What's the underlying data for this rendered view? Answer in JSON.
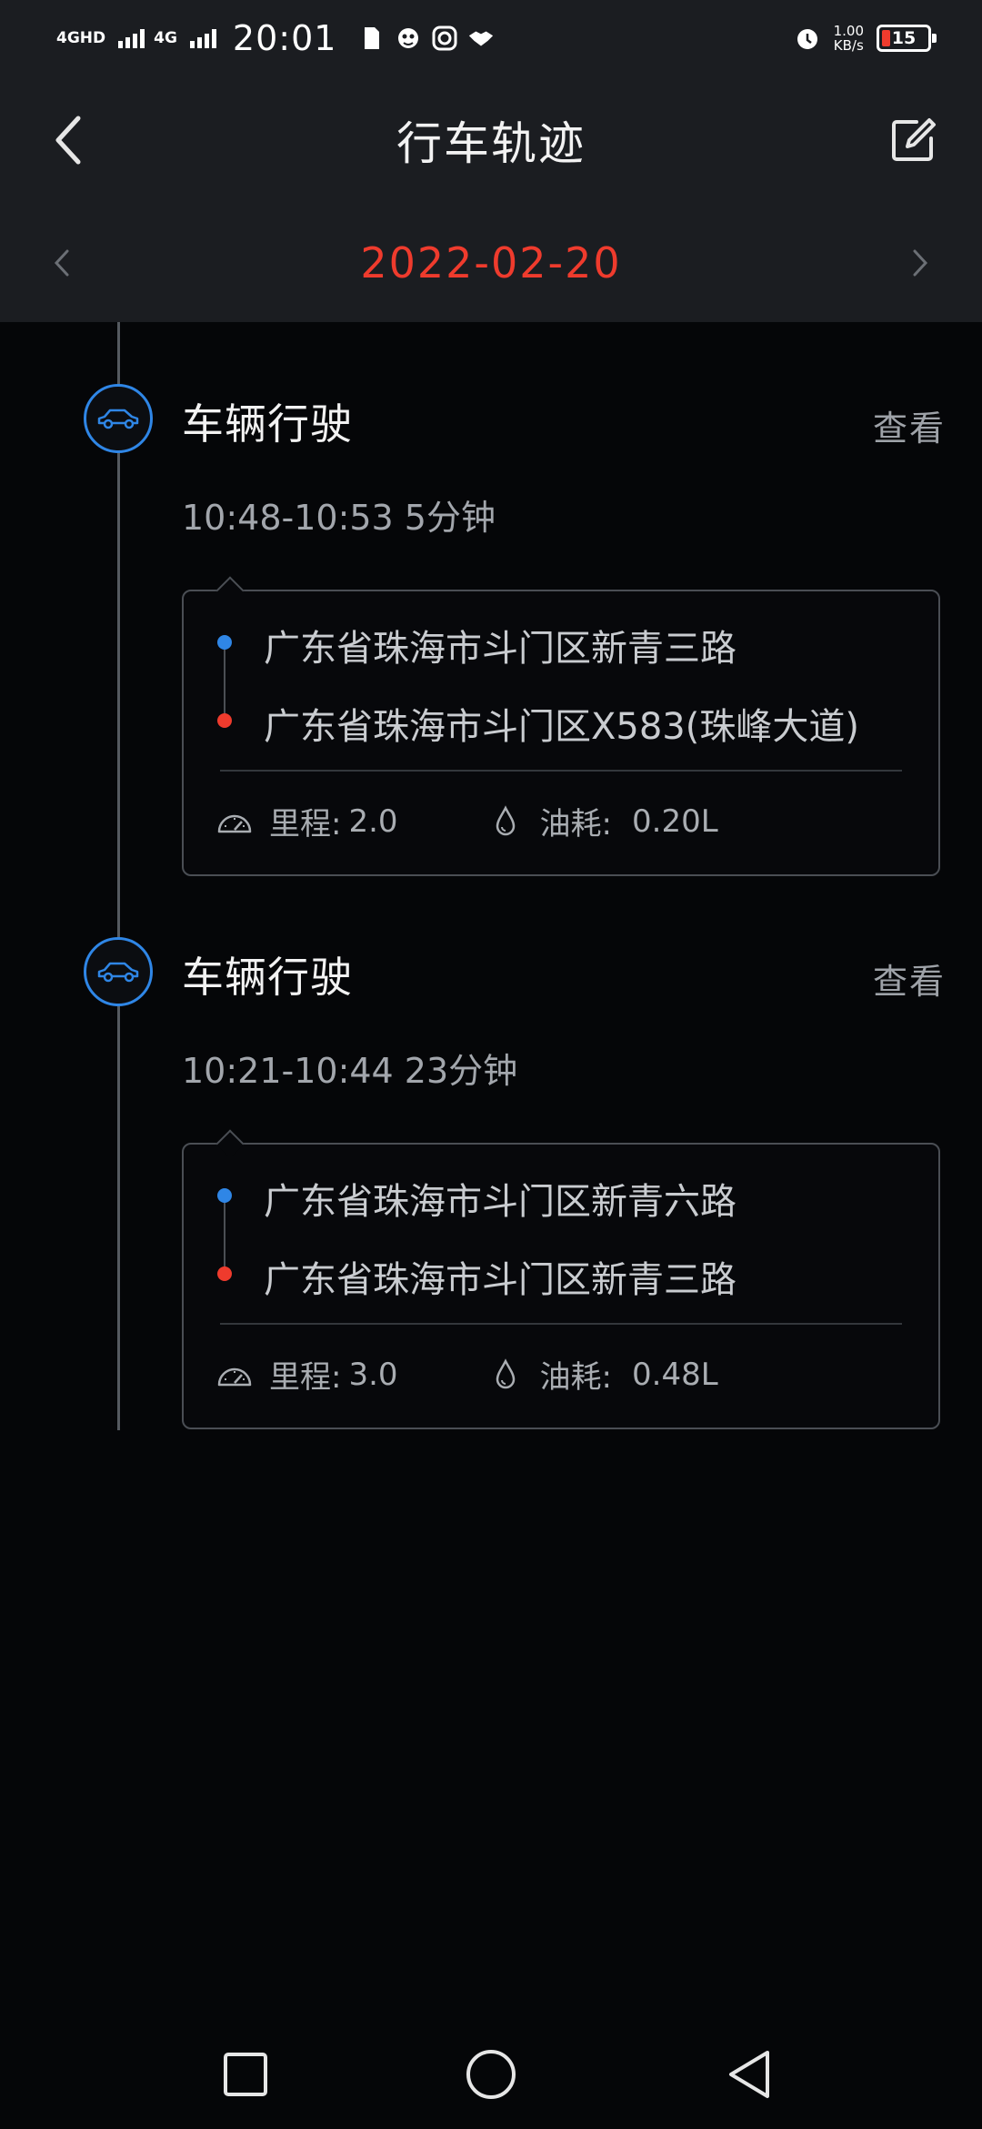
{
  "status_bar": {
    "network1": "4GHD",
    "network2": "4G",
    "time": "20:01",
    "speed_value": "1.00",
    "speed_unit": "KB/s",
    "battery": "15"
  },
  "header": {
    "title": "行车轨迹",
    "back_icon": "chevron-left-icon",
    "edit_icon": "edit-icon"
  },
  "date_bar": {
    "date": "2022-02-20",
    "prev_icon": "chevron-left-icon",
    "next_icon": "chevron-right-icon"
  },
  "trips": [
    {
      "title": "车辆行驶",
      "view_label": "查看",
      "time": "10:48-10:53 5分钟",
      "start_address": "广东省珠海市斗门区新青三路",
      "end_address": "广东省珠海市斗门区X583(珠峰大道)",
      "mileage_label": "里程:",
      "mileage": "2.0",
      "fuel_label": "油耗:",
      "fuel": "0.20L"
    },
    {
      "title": "车辆行驶",
      "view_label": "查看",
      "time": "10:21-10:44 23分钟",
      "start_address": "广东省珠海市斗门区新青六路",
      "end_address": "广东省珠海市斗门区新青三路",
      "mileage_label": "里程:",
      "mileage": "3.0",
      "fuel_label": "油耗:",
      "fuel": "0.48L"
    }
  ],
  "colors": {
    "accent_red": "#ef3b2d",
    "accent_blue": "#2f86e6",
    "background": "#050608",
    "header_bg": "#1b1d21"
  }
}
